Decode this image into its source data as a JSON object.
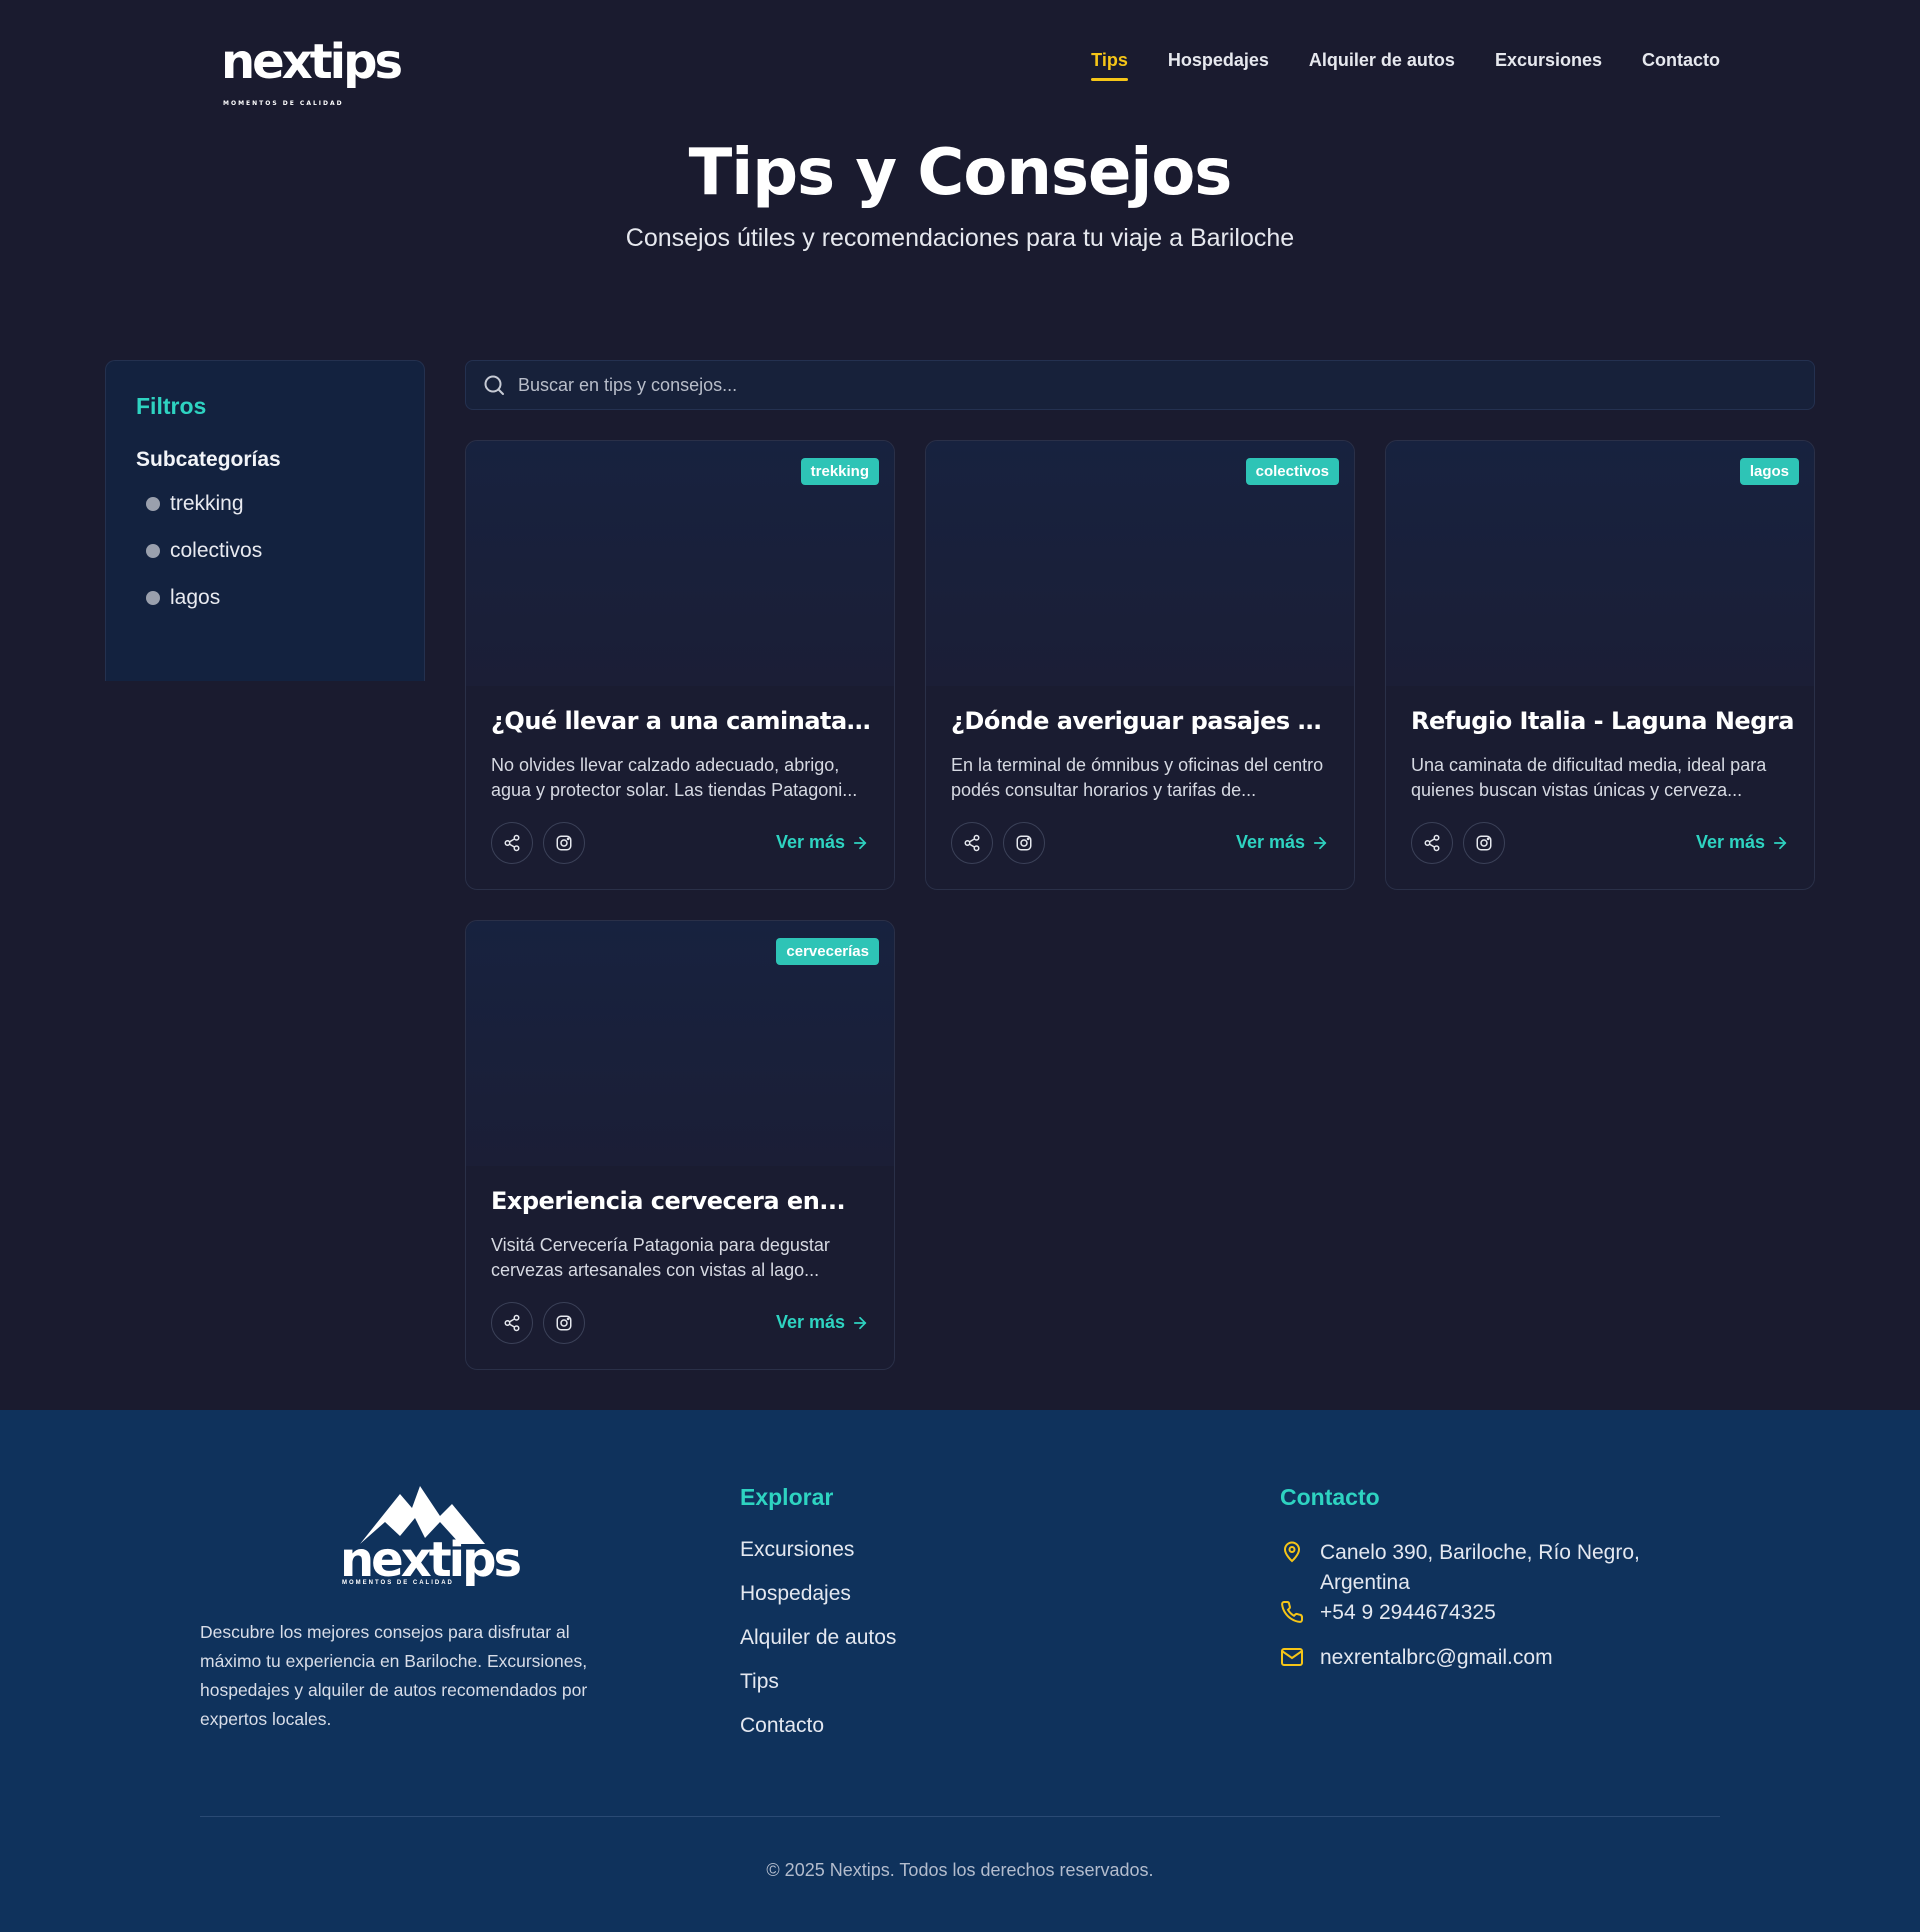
{
  "header": {
    "logo": "nextips",
    "logo_tagline": "MOMENTOS DE CALIDAD",
    "nav": [
      {
        "label": "Tips",
        "active": true
      },
      {
        "label": "Hospedajes",
        "active": false
      },
      {
        "label": "Alquiler de autos",
        "active": false
      },
      {
        "label": "Excursiones",
        "active": false
      },
      {
        "label": "Contacto",
        "active": false
      }
    ]
  },
  "hero": {
    "title": "Tips y Consejos",
    "subtitle": "Consejos útiles y recomendaciones para tu viaje a Bariloche"
  },
  "filters": {
    "title": "Filtros",
    "subtitle": "Subcategorías",
    "items": [
      "trekking",
      "colectivos",
      "lagos"
    ]
  },
  "search": {
    "placeholder": "Buscar en tips y consejos..."
  },
  "cards": [
    {
      "badge": "trekking",
      "title": "¿Qué llevar a una caminata de...",
      "desc": "No olvides llevar calzado adecuado, abrigo, agua y protector solar. Las tiendas Patagoni...",
      "cta": "Ver más"
    },
    {
      "badge": "colectivos",
      "title": "¿Dónde averiguar pasajes de...",
      "desc": "En la terminal de ómnibus y oficinas del centro podés consultar horarios y tarifas de...",
      "cta": "Ver más"
    },
    {
      "badge": "lagos",
      "title": "Refugio Italia - Laguna Negra",
      "desc": "Una caminata de dificultad media, ideal para quienes buscan vistas únicas y cerveza...",
      "cta": "Ver más"
    },
    {
      "badge": "cervecerías",
      "title": "Experiencia cervecera en...",
      "desc": "Visitá Cervecería Patagonia para degustar cervezas artesanales con vistas al lago...",
      "cta": "Ver más"
    }
  ],
  "footer": {
    "logo": "nextips",
    "logo_tagline": "MOMENTOS DE CALIDAD",
    "description": "Descubre los mejores consejos para disfrutar al máximo tu experiencia en Bariloche. Excursiones, hospedajes y alquiler de autos recomendados por expertos locales.",
    "explore_title": "Explorar",
    "explore_links": [
      "Excursiones",
      "Hospedajes",
      "Alquiler de autos",
      "Tips",
      "Contacto"
    ],
    "contact_title": "Contacto",
    "address": "Canelo 390, Bariloche, Río Negro, Argentina",
    "phone": "+54 9 2944674325",
    "email": "nexrentalbrc@gmail.com",
    "copyright": "© 2025 Nextips. Todos los derechos reservados."
  },
  "colors": {
    "background": "#1a1b2f",
    "accent_teal": "#2ed3c1",
    "accent_yellow": "#f5c518",
    "footer_bg": "#0f325c"
  }
}
